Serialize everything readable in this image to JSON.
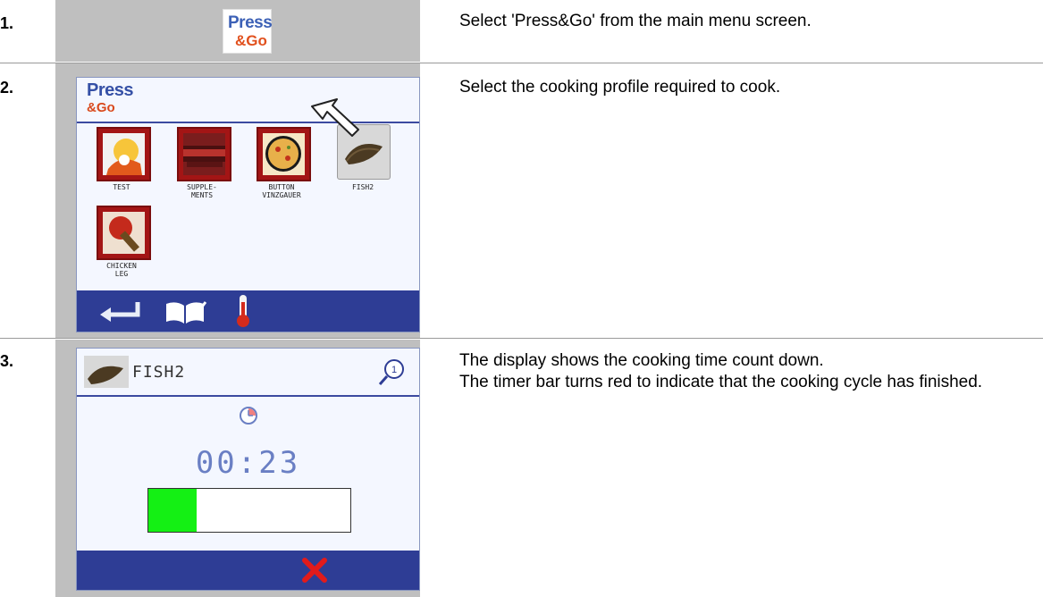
{
  "steps": [
    {
      "number": "1.",
      "text": "Select 'Press&Go' from the main menu screen."
    },
    {
      "number": "2.",
      "text": "Select the cooking profile required to cook."
    },
    {
      "number": "3.",
      "text_line1": "The display shows the cooking time count down.",
      "text_line2": "The timer bar turns red to indicate that the cooking cycle has finished."
    }
  ],
  "press_go_button": {
    "line1": "Press",
    "line2": "&Go"
  },
  "menu_screen": {
    "header_line1": "Press",
    "header_line2": "&Go",
    "profiles": [
      {
        "label_line1": "TEST",
        "label_line2": ""
      },
      {
        "label_line1": "SUPPLE-",
        "label_line2": "MENTS"
      },
      {
        "label_line1": "BUTTON",
        "label_line2": "VINZGAUER"
      },
      {
        "label_line1": "FISH2",
        "label_line2": ""
      },
      {
        "label_line1": "CHICKEN",
        "label_line2": "LEG"
      }
    ],
    "footer_icons": [
      "back-arrow-icon",
      "book-edit-icon",
      "thermometer-icon"
    ]
  },
  "timer_screen": {
    "profile_name": "FISH2",
    "magnifier_badge": "1",
    "timer": "00:23",
    "progress_fraction": 0.24,
    "progress_color": "#14f014",
    "cancel_icon": "cancel-x-icon"
  },
  "colors": {
    "panel_gray": "#bfbfbf",
    "screen_blue": "#2e3d95",
    "tile_red": "#a31515",
    "cancel_red": "#e21b1b"
  }
}
